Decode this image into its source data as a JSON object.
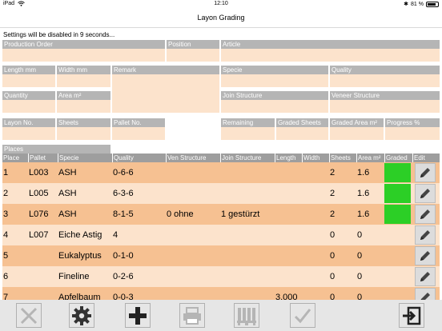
{
  "status_bar": {
    "device": "iPad",
    "time": "12:10",
    "battery": "81 %",
    "battery_level": 0.81
  },
  "nav": {
    "title": "Layon Grading"
  },
  "settings_message": "Settings will be disabled in 9 seconds...",
  "form": {
    "production_order": "Production Order",
    "position": "Position",
    "article": "Article",
    "length_mm": "Length mm",
    "width_mm": "Width mm",
    "remark": "Remark",
    "specie": "Specie",
    "quality": "Quality",
    "quantity": "Quantity",
    "area": "Area m²",
    "join_structure": "Join Structure",
    "veneer_structure": "Veneer Structure",
    "layon_no": "Layon No.",
    "sheets": "Sheets",
    "pallet_no": "Pallet No.",
    "remaining": "Remaining",
    "graded_sheets": "Graded Sheets",
    "graded_area": "Graded Area m²",
    "progress": "Progress %",
    "places": "Places"
  },
  "table": {
    "columns": [
      "Place",
      "Pallet",
      "Specie",
      "Quality",
      "Ven Structure",
      "Join Structure",
      "Length",
      "Width",
      "Sheets",
      "Area m²",
      "Graded",
      "Edit"
    ],
    "rows": [
      {
        "place": "1",
        "pallet": "L003",
        "specie": "ASH",
        "quality": "0-6-6",
        "ven_structure": "",
        "join_structure": "",
        "length": "",
        "width": "",
        "sheets": "2",
        "area": "1.6",
        "graded": true
      },
      {
        "place": "2",
        "pallet": "L005",
        "specie": "ASH",
        "quality": "6-3-6",
        "ven_structure": "",
        "join_structure": "",
        "length": "",
        "width": "",
        "sheets": "2",
        "area": "1.6",
        "graded": true
      },
      {
        "place": "3",
        "pallet": "L076",
        "specie": "ASH",
        "quality": "8-1-5",
        "ven_structure": "0 ohne",
        "join_structure": "1 gestürzt",
        "length": "",
        "width": "",
        "sheets": "2",
        "area": "1.6",
        "graded": true
      },
      {
        "place": "4",
        "pallet": "L007",
        "specie": "Eiche Astig",
        "quality": "4",
        "ven_structure": "",
        "join_structure": "",
        "length": "",
        "width": "",
        "sheets": "0",
        "area": "0",
        "graded": false
      },
      {
        "place": "5",
        "pallet": "",
        "specie": "Eukalyptus",
        "quality": "0-1-0",
        "ven_structure": "",
        "join_structure": "",
        "length": "",
        "width": "",
        "sheets": "0",
        "area": "0",
        "graded": false
      },
      {
        "place": "6",
        "pallet": "",
        "specie": "Fineline",
        "quality": "0-2-6",
        "ven_structure": "",
        "join_structure": "",
        "length": "",
        "width": "",
        "sheets": "0",
        "area": "0",
        "graded": false
      },
      {
        "place": "7",
        "pallet": "",
        "specie": "Apfelbaum",
        "quality": "0-0-3",
        "ven_structure": "",
        "join_structure": "",
        "length": "3.000",
        "width": "",
        "sheets": "0",
        "area": "0",
        "graded": false
      }
    ]
  },
  "colors": {
    "label_gray": "#b5b5b5",
    "field_peach": "#fce3cc",
    "row_orange": "#f6c192",
    "graded_green": "#2ccf26"
  },
  "toolbar": {
    "buttons": [
      "close-icon",
      "gear-icon",
      "plus-icon",
      "printer-icon",
      "pallet-icon",
      "checkmark-icon",
      "logout-icon"
    ]
  }
}
